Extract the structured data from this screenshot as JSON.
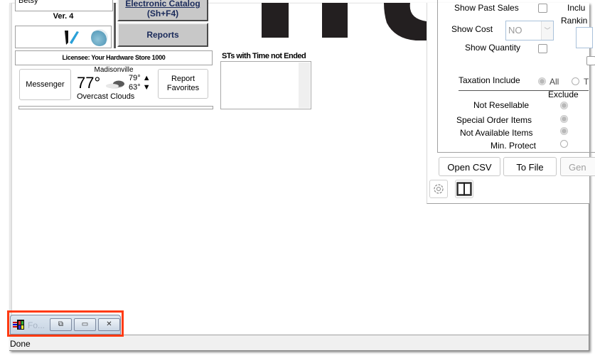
{
  "left": {
    "user_name": "Betsy",
    "version": "Ver. 4",
    "electronic_catalog_label": "Electronic Catalog",
    "electronic_catalog_shortcut": "(Sh+F4)",
    "reports_label": "Reports",
    "licensee": "Licensee: Your Hardware Store 1000",
    "messenger_label": "Messenger",
    "weather": {
      "city": "Madisonville",
      "temperature": "77°",
      "high": "79°",
      "low": "63°",
      "condition": "Overcast Clouds",
      "icon": "cloud-icon"
    },
    "report_favorites_line1": "Report",
    "report_favorites_line2": "Favorites"
  },
  "middle": {
    "st_label": "STs with Time not Ended",
    "st_items": []
  },
  "right_panel": {
    "show_past_sales_label": "Show Past Sales",
    "show_past_sales_checked": false,
    "include_label": "Inclu",
    "ranking_label": "Rankin",
    "show_cost_label": "Show Cost",
    "show_cost_value": "NO",
    "show_quantity_label": "Show Quantity",
    "show_quantity_checked": false,
    "taxation_include_label": "Taxation Include",
    "taxation_options": [
      {
        "label": "All",
        "selected": true
      },
      {
        "label": "T",
        "selected": false
      }
    ],
    "exclude_label": "Exclude",
    "exclude_rows": [
      {
        "label": "Not Resellable",
        "selected": true
      },
      {
        "label": "Special  Order Items",
        "selected": true
      },
      {
        "label": "Not  Available Items",
        "selected": true
      },
      {
        "label": "Min. Protect",
        "selected": false
      }
    ],
    "buttons": {
      "open_csv": "Open CSV",
      "to_file": "To File",
      "generate": "Gen"
    },
    "icons": [
      "gear-icon",
      "book-icon"
    ]
  },
  "minimized_window": {
    "title": "Fo...",
    "restore_icon": "restore-icon",
    "maximize_icon": "maximize-icon",
    "close_icon": "close-icon"
  },
  "status_bar": {
    "text": "Done"
  },
  "highlight_color": "#ff3a12"
}
